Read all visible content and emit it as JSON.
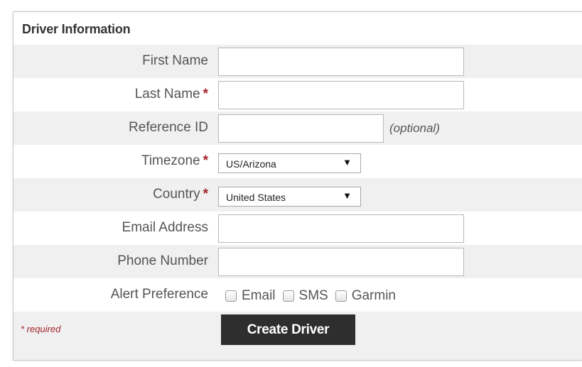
{
  "section": {
    "title": "Driver Information"
  },
  "fields": {
    "first_name": {
      "label": "First Name",
      "value": ""
    },
    "last_name": {
      "label": "Last Name",
      "required_mark": "*",
      "value": ""
    },
    "reference_id": {
      "label": "Reference ID",
      "value": "",
      "note": "(optional)"
    },
    "timezone": {
      "label": "Timezone",
      "required_mark": "*",
      "selected": "US/Arizona",
      "arrow": "▼"
    },
    "country": {
      "label": "Country",
      "required_mark": "*",
      "selected": "United States",
      "arrow": "▼"
    },
    "email": {
      "label": "Email Address",
      "value": ""
    },
    "phone": {
      "label": "Phone Number",
      "value": ""
    },
    "alert_preference": {
      "label": "Alert Preference",
      "options": [
        {
          "label": "Email",
          "checked": false
        },
        {
          "label": "SMS",
          "checked": false
        },
        {
          "label": "Garmin",
          "checked": false
        }
      ]
    }
  },
  "footer": {
    "required_note": "* required",
    "create_button": "Create Driver"
  },
  "colors": {
    "required_accent": "#a3232c",
    "button_bg": "#2e2e2e",
    "row_alt_bg": "#f0f0f0"
  }
}
